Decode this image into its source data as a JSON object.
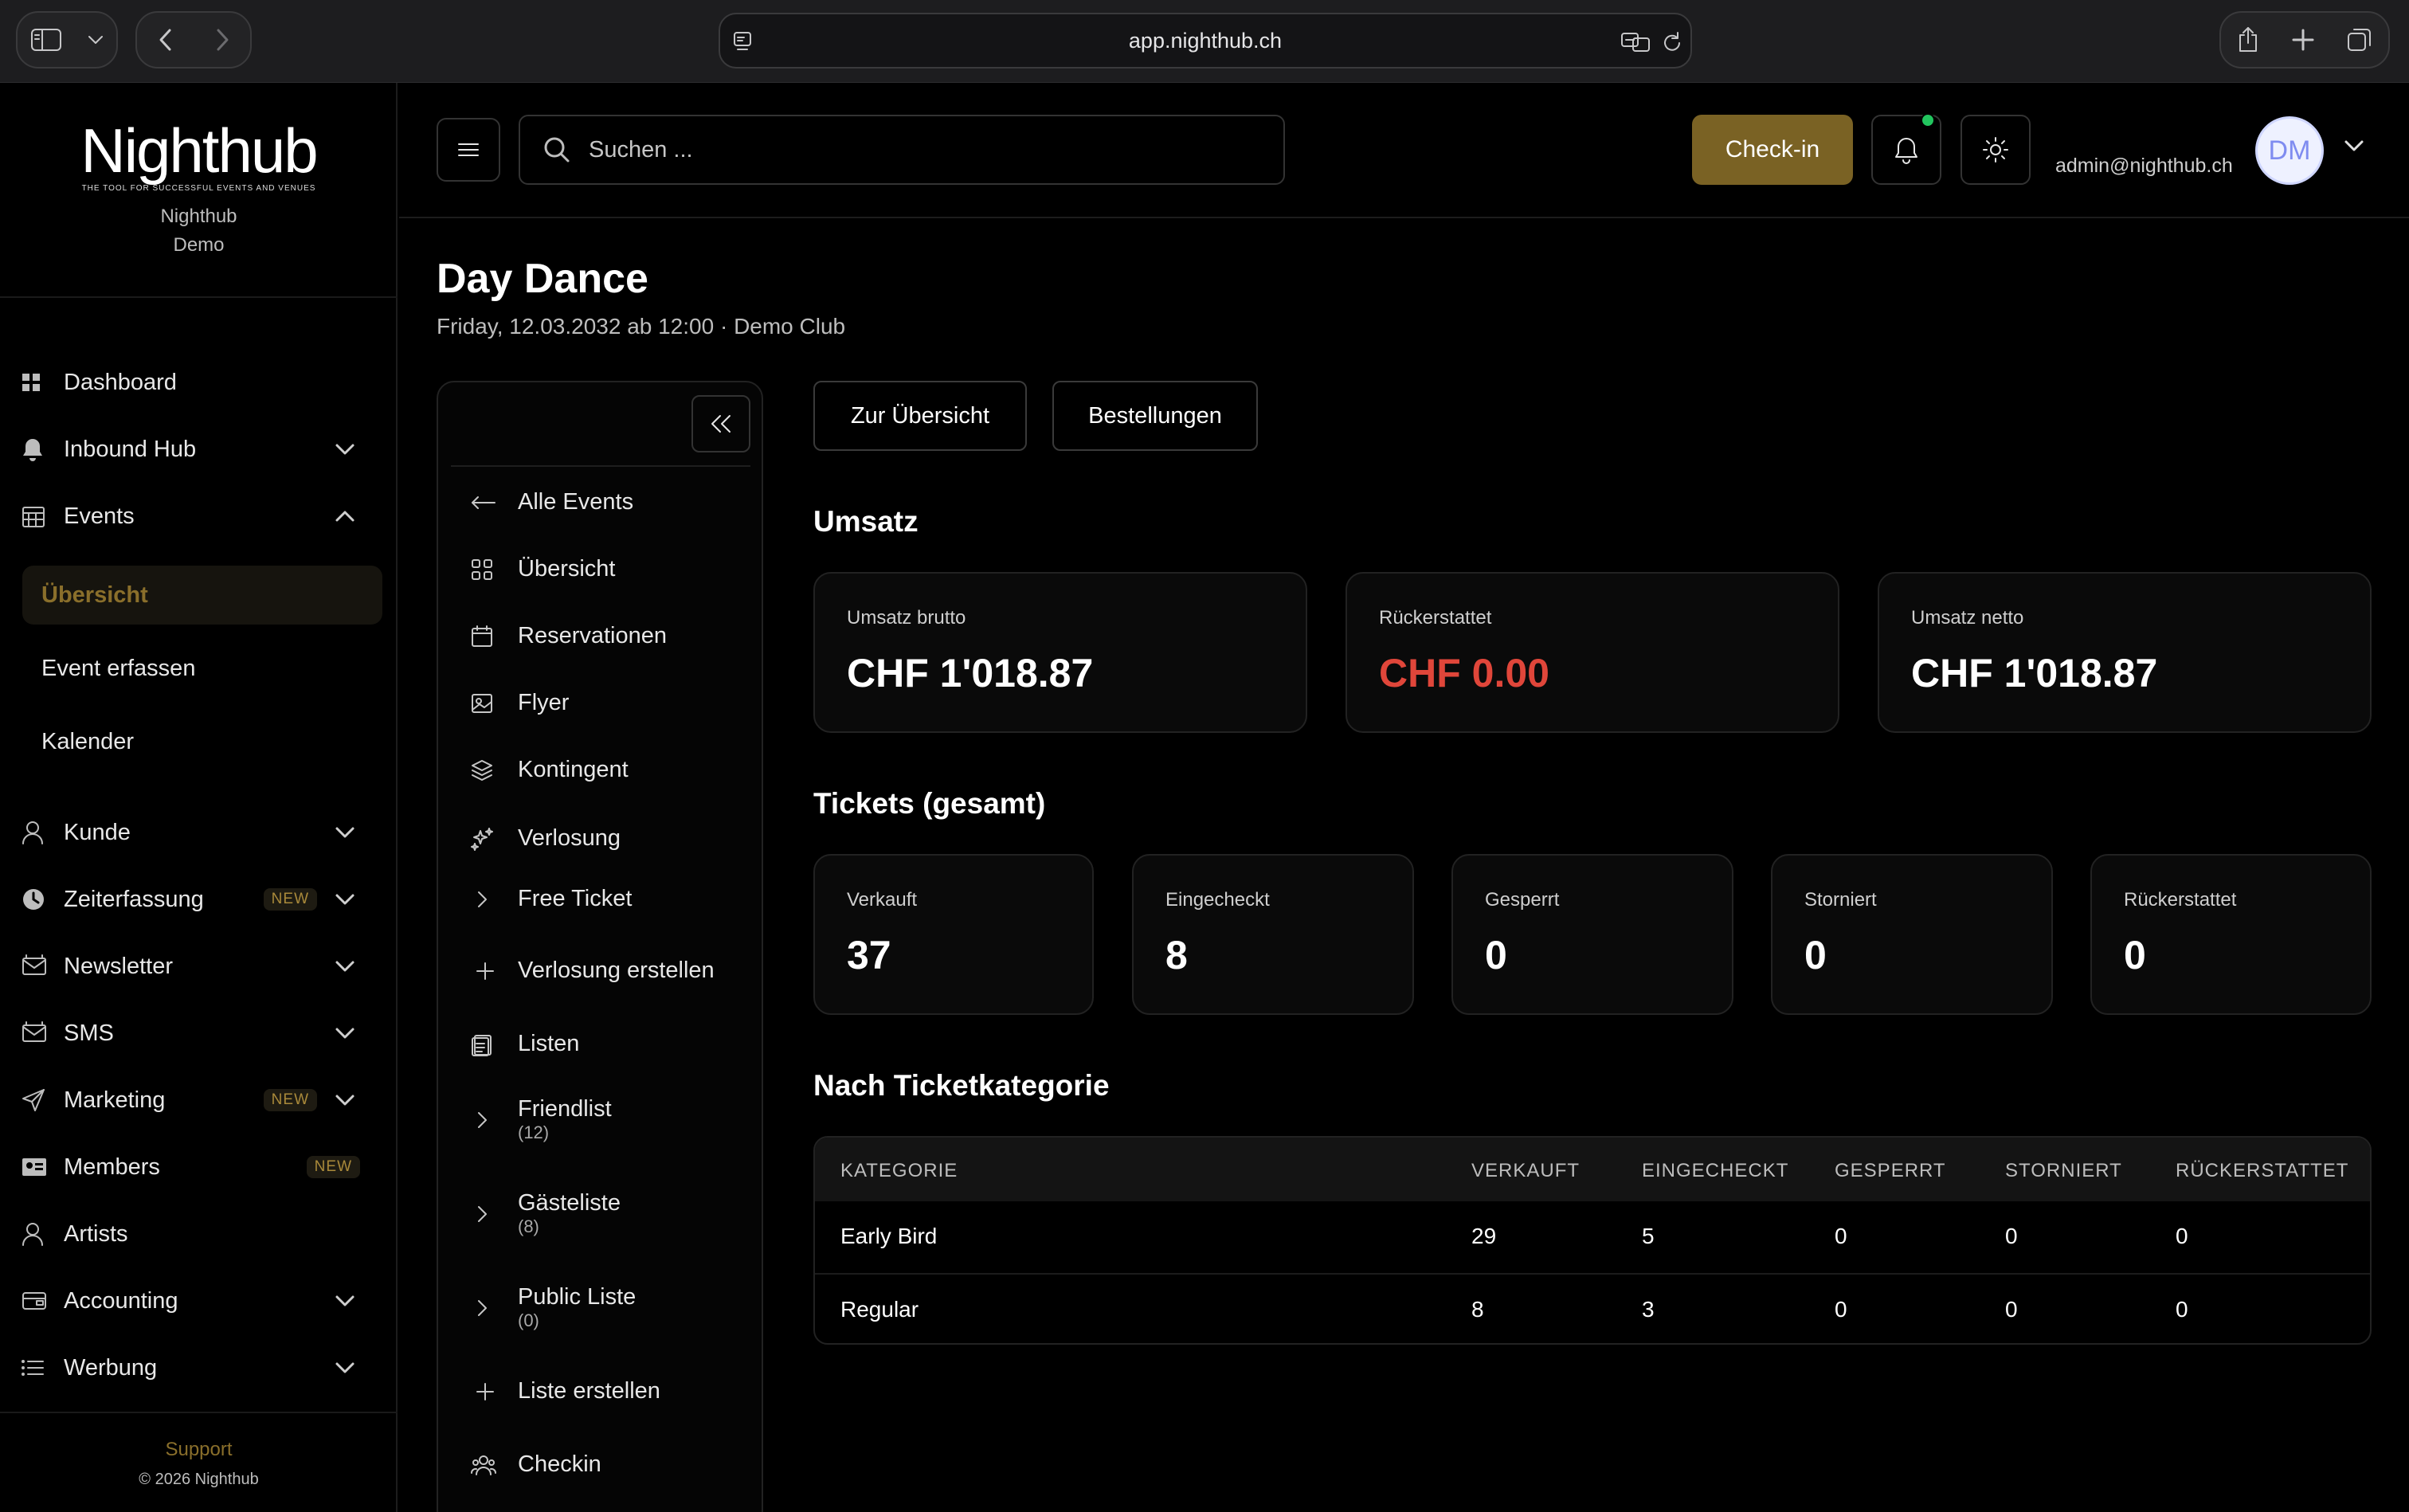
{
  "browser": {
    "url": "app.nighthub.ch"
  },
  "sidebar": {
    "logo": {
      "wordmark": "Nighthub",
      "tagline": "THE TOOL FOR SUCCESSFUL EVENTS AND VENUES"
    },
    "org_line1": "Nighthub",
    "org_line2": "Demo",
    "nav": [
      {
        "label": "Dashboard",
        "icon": "grid-icon"
      },
      {
        "label": "Inbound Hub",
        "icon": "bell-icon",
        "chevron": "down"
      },
      {
        "label": "Events",
        "icon": "calendar-icon",
        "chevron": "up"
      }
    ],
    "events_sub": [
      {
        "label": "Übersicht",
        "active": true
      },
      {
        "label": "Event erfassen"
      },
      {
        "label": "Kalender"
      }
    ],
    "nav2": [
      {
        "label": "Kunde",
        "icon": "user-icon",
        "chevron": "down"
      },
      {
        "label": "Zeiterfassung",
        "icon": "clock-icon",
        "badge": "NEW",
        "chevron": "down"
      },
      {
        "label": "Newsletter",
        "icon": "mail-icon",
        "chevron": "down"
      },
      {
        "label": "SMS",
        "icon": "message-icon",
        "chevron": "down"
      },
      {
        "label": "Marketing",
        "icon": "send-icon",
        "badge": "NEW",
        "chevron": "down"
      },
      {
        "label": "Members",
        "icon": "id-card-icon",
        "badge": "NEW"
      },
      {
        "label": "Artists",
        "icon": "user-icon"
      },
      {
        "label": "Accounting",
        "icon": "wallet-icon",
        "chevron": "down"
      },
      {
        "label": "Werbung",
        "icon": "list-icon",
        "chevron": "down"
      }
    ],
    "footer": {
      "support": "Support",
      "copyright": "© 2026 Nighthub"
    }
  },
  "header": {
    "search_placeholder": "Suchen ...",
    "checkin_label": "Check-in",
    "email": "admin@nighthub.ch",
    "avatar_initials": "DM",
    "colors": {
      "accent": "#7a6224",
      "notification": "#22c55e"
    }
  },
  "event": {
    "title": "Day Dance",
    "subtitle": "Friday, 12.03.2032 ab 12:00 · Demo Club"
  },
  "subnav": {
    "items": [
      {
        "label": "Alle Events",
        "icon": "arrow-left-icon"
      },
      {
        "label": "Übersicht",
        "icon": "grid-icon"
      },
      {
        "label": "Reservationen",
        "icon": "calendar-icon"
      },
      {
        "label": "Flyer",
        "icon": "image-icon"
      },
      {
        "label": "Kontingent",
        "icon": "layers-icon"
      },
      {
        "label": "Verlosung",
        "icon": "sparkles-icon"
      }
    ],
    "verlosung_children": [
      {
        "label": "Free Ticket",
        "icon": "chevron-right-icon"
      },
      {
        "label": "Verlosung erstellen",
        "icon": "plus-icon"
      }
    ],
    "listen_label": "Listen",
    "listen_children": [
      {
        "label": "Friendlist",
        "count": "(12)"
      },
      {
        "label": "Gästeliste",
        "count": "(8)"
      },
      {
        "label": "Public Liste",
        "count": "(0)"
      }
    ],
    "create_list_label": "Liste erstellen",
    "checkin_label": "Checkin"
  },
  "actions": {
    "overview": "Zur Übersicht",
    "orders": "Bestellungen"
  },
  "revenue": {
    "title": "Umsatz",
    "cards": [
      {
        "label": "Umsatz brutto",
        "value": "CHF 1'018.87",
        "color": "#ffffff"
      },
      {
        "label": "Rückerstattet",
        "value": "CHF 0.00",
        "color": "#e0463a"
      },
      {
        "label": "Umsatz netto",
        "value": "CHF 1'018.87",
        "color": "#ffffff"
      }
    ]
  },
  "tickets": {
    "title": "Tickets (gesamt)",
    "cards": [
      {
        "label": "Verkauft",
        "value": "37"
      },
      {
        "label": "Eingecheckt",
        "value": "8"
      },
      {
        "label": "Gesperrt",
        "value": "0"
      },
      {
        "label": "Storniert",
        "value": "0"
      },
      {
        "label": "Rückerstattet",
        "value": "0"
      }
    ]
  },
  "categories": {
    "title": "Nach Ticketkategorie",
    "headers": [
      "KATEGORIE",
      "VERKAUFT",
      "EINGECHECKT",
      "GESPERRT",
      "STORNIERT",
      "RÜCKERSTATTET"
    ],
    "rows": [
      [
        "Early Bird",
        "29",
        "5",
        "0",
        "0",
        "0"
      ],
      [
        "Regular",
        "8",
        "3",
        "0",
        "0",
        "0"
      ]
    ]
  }
}
